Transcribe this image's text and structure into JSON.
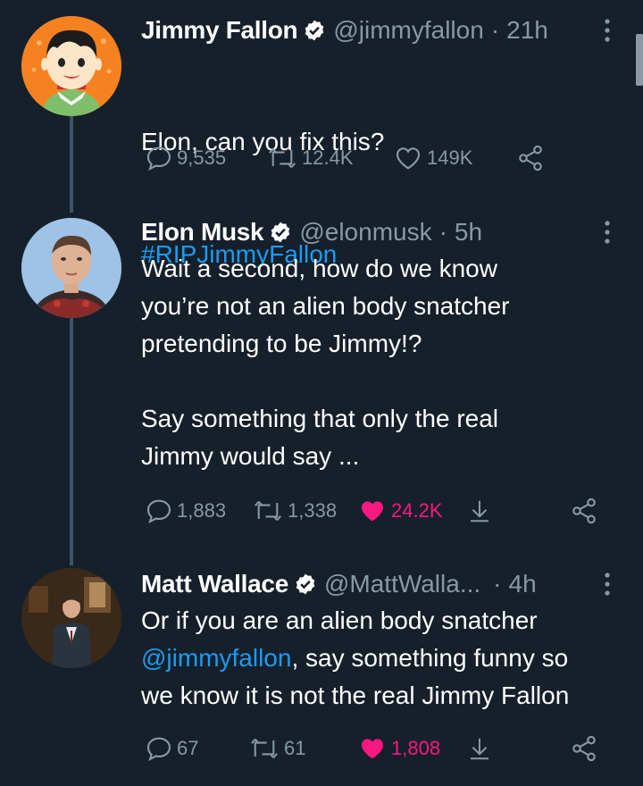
{
  "colors": {
    "background": "#15202b",
    "text": "#ffffff",
    "muted": "#8899a6",
    "link": "#1d9bf0",
    "like": "#f91880",
    "thread_line": "#3d5466"
  },
  "tweets": [
    {
      "name": "Jimmy Fallon",
      "handle": "@jimmyfallon",
      "separator": "·",
      "time": "21h",
      "text": "Elon, can you fix this?",
      "hashtag": "#RIPJimmyFallon",
      "replies": "9,535",
      "retweets": "12.4K",
      "likes": "149K",
      "liked": false
    },
    {
      "name": "Elon Musk",
      "handle": "@elonmusk",
      "separator": "·",
      "time": "5h",
      "text": "Wait a second, how do we know\nyou’re not an alien body snatcher\npretending to be Jimmy!?\n\nSay something that only the real\nJimmy would say ...",
      "replies": "1,883",
      "retweets": "1,338",
      "likes": "24.2K",
      "liked": true
    },
    {
      "name": "Matt Wallace",
      "handle": "@MattWalla...",
      "separator": "·",
      "time": "4h",
      "text_line1": "Or if you are an alien body snatcher",
      "mention": "@jimmyfallon",
      "text_after_mention": ", say something funny so\nwe know it is not the real Jimmy Fallon",
      "replies": "67",
      "retweets": "61",
      "likes": "1,808",
      "liked": true
    }
  ],
  "icons": {
    "verified": "verified-badge-icon",
    "more": "more-vertical-icon",
    "reply": "reply-bubble-icon",
    "retweet": "retweet-icon",
    "like": "heart-icon",
    "save": "save-arrow-icon",
    "share": "share-icon"
  }
}
